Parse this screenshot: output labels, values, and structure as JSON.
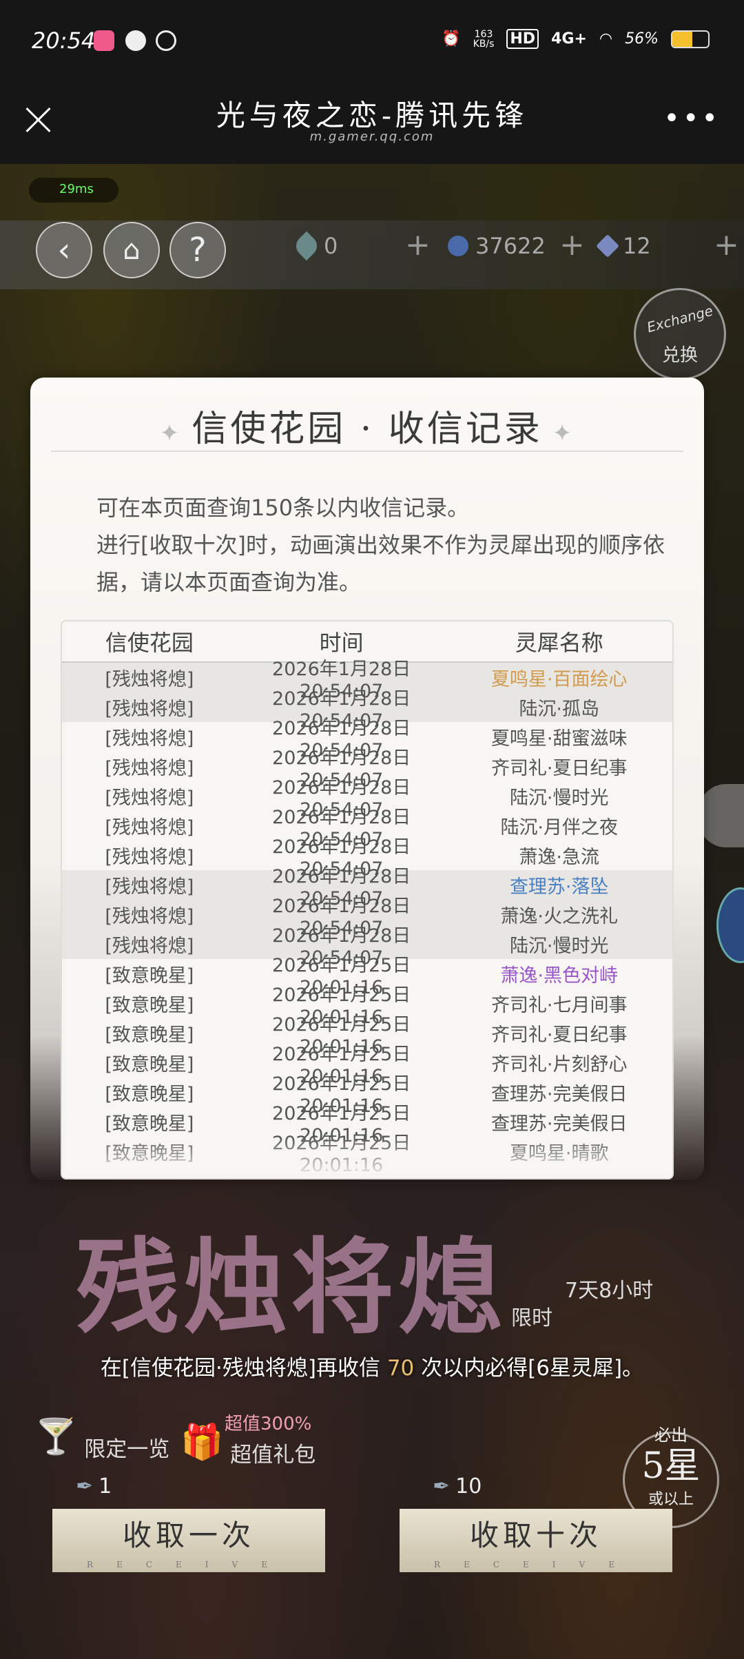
{
  "statusbar": {
    "time": "20:54",
    "speed_top": "163",
    "speed_bottom": "KB/s",
    "hd": "HD",
    "network": "4G+",
    "battery": "56%",
    "battery_level": 0.56
  },
  "titlebar": {
    "title": "光与夜之恋-腾讯先锋",
    "url": "m.gamer.qq.com"
  },
  "hud": {
    "ping": "29ms",
    "currency1": "0",
    "currency2": "37622",
    "currency3": "12",
    "exchange_label": "兑换",
    "exchange_script": "Exchange"
  },
  "modal": {
    "title": "信使花园 · 收信记录",
    "notes": [
      "可在本页面查询150条以内收信记录。",
      "进行[收取十次]时，动画演出效果不作为灵犀出现的顺序依据，请以本页面查询为准。"
    ],
    "headers": [
      "信使花园",
      "时间",
      "灵犀名称"
    ],
    "rows": [
      {
        "garden": "[残烛将熄]",
        "time": "2026年1月28日 20:54:07",
        "name": "夏鸣星·百面绘心",
        "color": "#d19a4c",
        "alt": true
      },
      {
        "garden": "[残烛将熄]",
        "time": "2026年1月28日 20:54:07",
        "name": "陆沉·孤岛",
        "color": "#555555",
        "alt": true
      },
      {
        "garden": "[残烛将熄]",
        "time": "2026年1月28日 20:54:07",
        "name": "夏鸣星·甜蜜滋味",
        "color": "#555555",
        "alt": false
      },
      {
        "garden": "[残烛将熄]",
        "time": "2026年1月28日 20:54:07",
        "name": "齐司礼·夏日纪事",
        "color": "#555555",
        "alt": false
      },
      {
        "garden": "[残烛将熄]",
        "time": "2026年1月28日 20:54:07",
        "name": "陆沉·慢时光",
        "color": "#555555",
        "alt": false
      },
      {
        "garden": "[残烛将熄]",
        "time": "2026年1月28日 20:54:07",
        "name": "陆沉·月伴之夜",
        "color": "#555555",
        "alt": false
      },
      {
        "garden": "[残烛将熄]",
        "time": "2026年1月28日 20:54:07",
        "name": "萧逸·急流",
        "color": "#555555",
        "alt": false
      },
      {
        "garden": "[残烛将熄]",
        "time": "2026年1月28日 20:54:07",
        "name": "查理苏·落坠",
        "color": "#4a7fc0",
        "alt": true
      },
      {
        "garden": "[残烛将熄]",
        "time": "2026年1月28日 20:54:07",
        "name": "萧逸·火之洗礼",
        "color": "#555555",
        "alt": true
      },
      {
        "garden": "[残烛将熄]",
        "time": "2026年1月28日 20:54:07",
        "name": "陆沉·慢时光",
        "color": "#555555",
        "alt": true
      },
      {
        "garden": "[致意晚星]",
        "time": "2026年1月25日 20:01:16",
        "name": "萧逸·黑色对峙",
        "color": "#9a56c8",
        "alt": false
      },
      {
        "garden": "[致意晚星]",
        "time": "2026年1月25日 20:01:16",
        "name": "齐司礼·七月间事",
        "color": "#555555",
        "alt": false
      },
      {
        "garden": "[致意晚星]",
        "time": "2026年1月25日 20:01:16",
        "name": "齐司礼·夏日纪事",
        "color": "#555555",
        "alt": false
      },
      {
        "garden": "[致意晚星]",
        "time": "2026年1月25日 20:01:16",
        "name": "齐司礼·片刻舒心",
        "color": "#555555",
        "alt": false
      },
      {
        "garden": "[致意晚星]",
        "time": "2026年1月25日 20:01:16",
        "name": "查理苏·完美假日",
        "color": "#555555",
        "alt": false
      },
      {
        "garden": "[致意晚星]",
        "time": "2026年1月25日 20:01:16",
        "name": "查理苏·完美假日",
        "color": "#555555",
        "alt": false
      },
      {
        "garden": "[致意晚星]",
        "time": "2026年1月25日 20:01:16",
        "name": "夏鸣星·晴歌",
        "color": "#555555",
        "alt": false
      }
    ]
  },
  "banner": {
    "art_title": "残烛将熄",
    "limit_text": "限时",
    "countdown": "7天8小时",
    "pity_prefix": "在[信使花园·残烛将熄]再收信",
    "pity_count": "70",
    "pity_suffix": "次以内必得[6星灵犀]。"
  },
  "bottom": {
    "limited_view": "限定一览",
    "gift_tag": "超值300%",
    "gift_pack": "超值礼包",
    "guarantee_top": "必出",
    "guarantee_num": "5星",
    "guarantee_bottom": "或以上",
    "cost_one": "1",
    "cost_ten": "10",
    "pull_one": "收取一次",
    "pull_ten": "收取十次",
    "receive": "RECEIVE"
  },
  "colors": {
    "gold": "#d19a4c",
    "blue": "#4a7fc0",
    "purple": "#9a56c8"
  }
}
